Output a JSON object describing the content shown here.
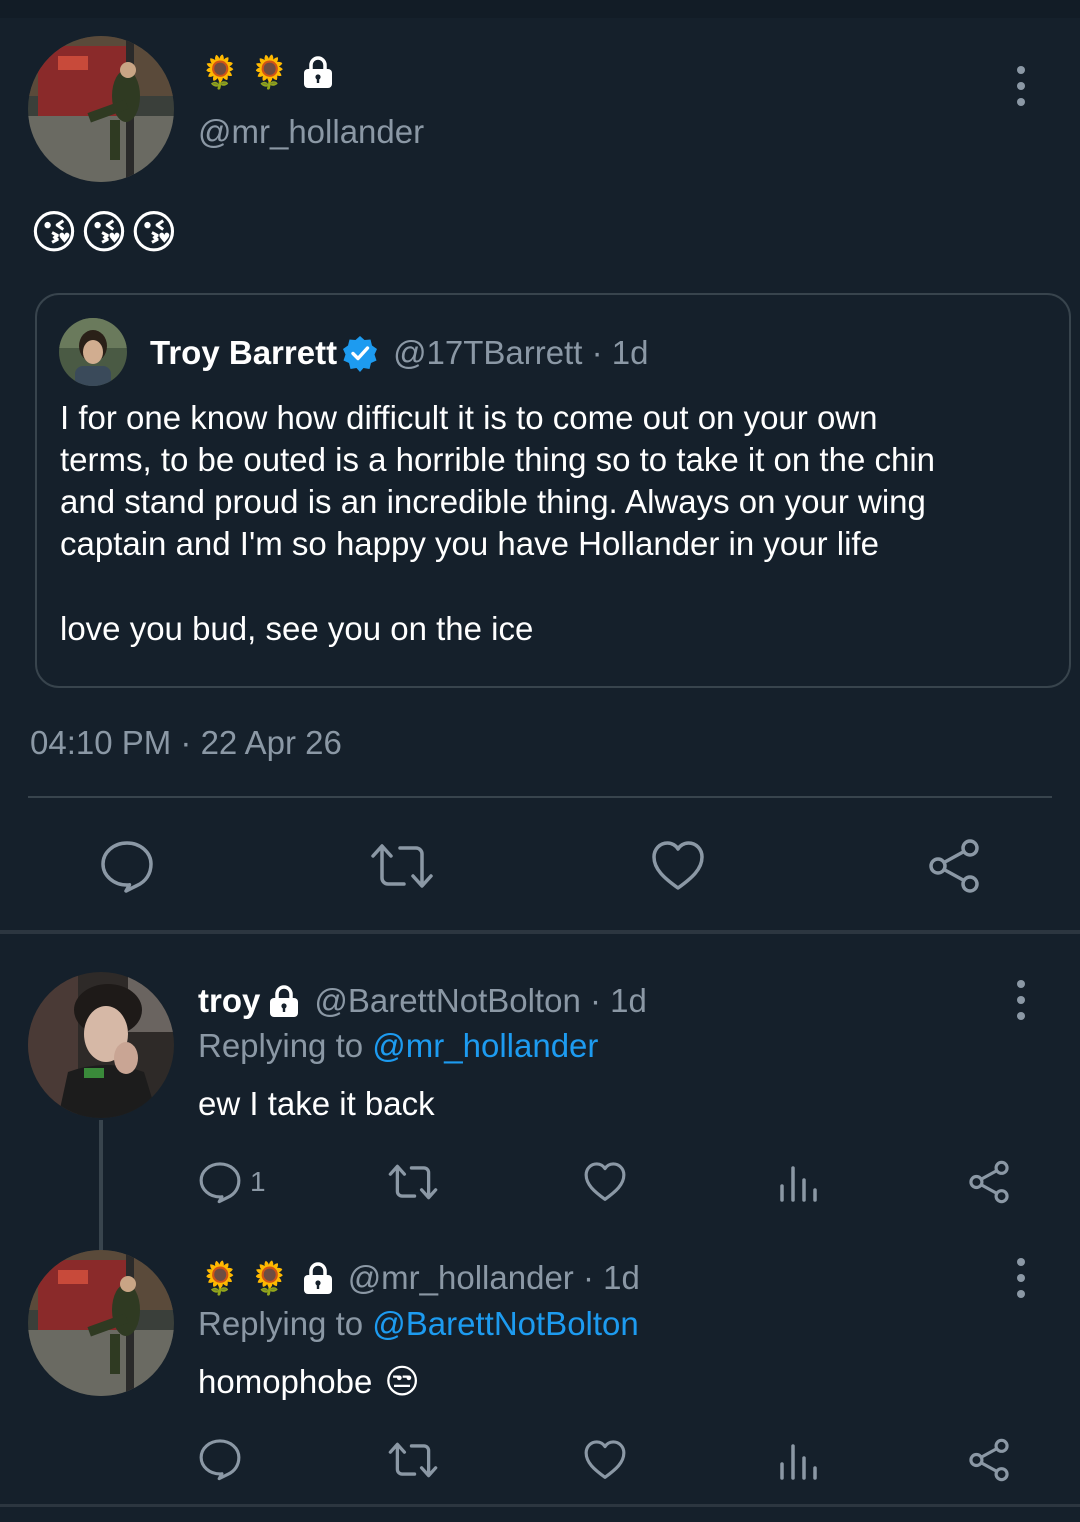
{
  "main_tweet": {
    "name_emojis": [
      "🌻",
      "🌻"
    ],
    "handle": "@mr_hollander",
    "text_emojis": "😘😘😘",
    "timestamp": "04:10 PM · 22 Apr 26",
    "quote": {
      "name": "Troy Barrett",
      "handle_time": "@17TBarrett · 1d",
      "line1": "I for one know how difficult it is to come out on your own",
      "line2": "terms, to be outed is a horrible thing so to take it on the chin",
      "line3": "and stand proud is an incredible thing. Always on your wing",
      "line4": "captain and I'm so happy you have Hollander in your life",
      "line5": "love you bud, see you on the ice"
    }
  },
  "reply1": {
    "name": "troy",
    "handle_time": "@BarettNotBolton · 1d",
    "replying_prefix": "Replying to",
    "replying_to": "@mr_hollander",
    "text": "ew I take it back",
    "reply_count": "1"
  },
  "reply2": {
    "name_emojis": [
      "🌻",
      "🌻"
    ],
    "handle_time": "@mr_hollander · 1d",
    "replying_prefix": "Replying to",
    "replying_to": "@BarettNotBolton",
    "text": "homophobe",
    "text_emoji": "😒"
  },
  "colors": {
    "background": "#15202b",
    "muted": "#8b98a5",
    "accent": "#1d9bf0",
    "divider": "#38444d"
  }
}
